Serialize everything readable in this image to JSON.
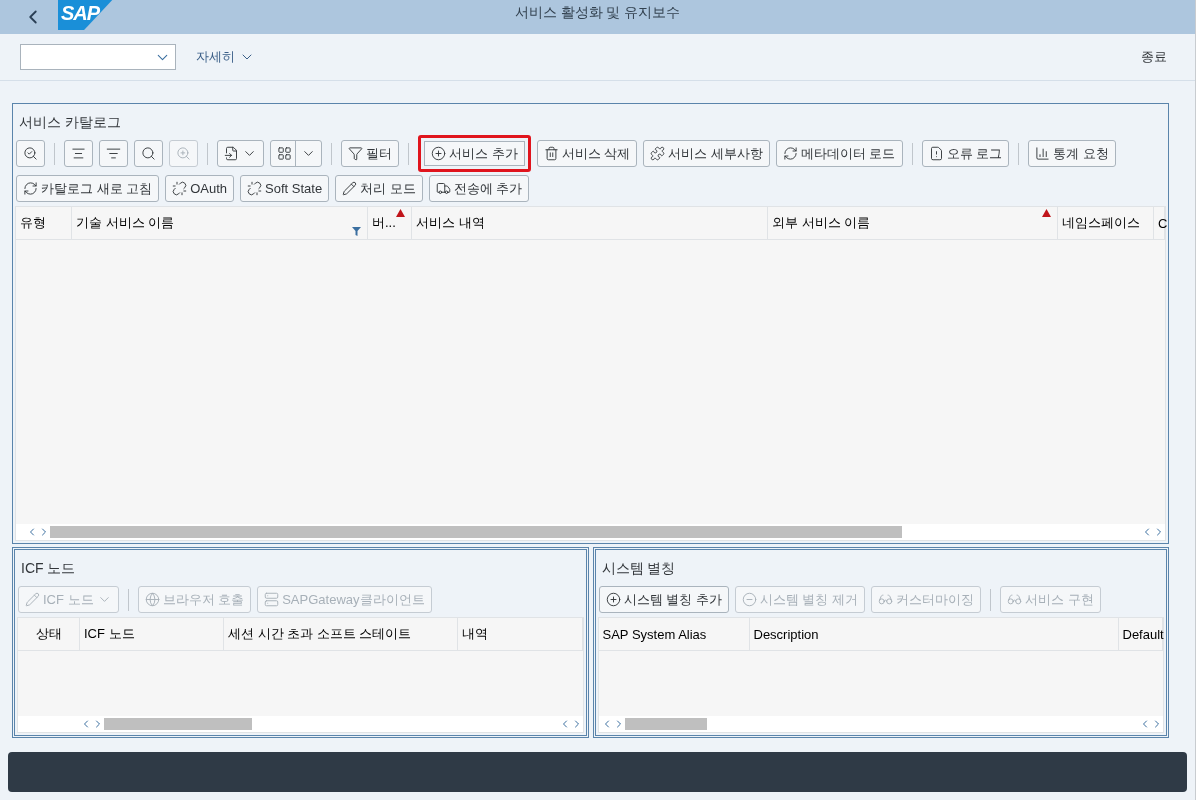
{
  "header": {
    "logo": "SAP",
    "title": "서비스 활성화 및 유지보수"
  },
  "toolbar": {
    "more": "자세히",
    "exit": "종료"
  },
  "catalog": {
    "title": "서비스 카탈로그",
    "toolbar_lines": [
      {
        "groups": [
          {
            "buttons": [
              {
                "kind": "icon",
                "disabled": false,
                "highlighted": false
              }
            ]
          },
          {
            "buttons": [
              {
                "kind": "icon",
                "disabled": false,
                "highlighted": false
              },
              {
                "kind": "icon",
                "disabled": false,
                "highlighted": false
              },
              {
                "kind": "icon",
                "disabled": false,
                "highlighted": false
              },
              {
                "kind": "icon",
                "disabled": true,
                "highlighted": false
              }
            ]
          },
          {
            "buttons": [
              {
                "kind": "icon-menu",
                "disabled": false,
                "highlighted": false
              },
              {
                "kind": "split-menu",
                "disabled": false,
                "highlighted": false
              }
            ]
          },
          {
            "buttons": [
              {
                "kind": "text",
                "label": "필터",
                "disabled": false,
                "highlighted": false
              }
            ]
          },
          {
            "buttons": [
              {
                "kind": "text",
                "label": "서비스 추가",
                "disabled": false,
                "highlighted": true
              },
              {
                "kind": "text",
                "label": "서비스 삭제",
                "disabled": false,
                "highlighted": false
              },
              {
                "kind": "text",
                "label": "서비스 세부사항",
                "disabled": false,
                "highlighted": false
              },
              {
                "kind": "text",
                "label": "메타데이터 로드",
                "disabled": false,
                "highlighted": false
              }
            ]
          },
          {
            "buttons": [
              {
                "kind": "text",
                "label": "오류 로그",
                "disabled": false,
                "highlighted": false
              }
            ]
          },
          {
            "buttons": [
              {
                "kind": "text",
                "label": "통계 요청",
                "disabled": false,
                "highlighted": false
              }
            ]
          }
        ]
      },
      {
        "groups": [
          {
            "buttons": [
              {
                "kind": "text",
                "label": "카탈로그 새로 고침",
                "disabled": false,
                "highlighted": false
              },
              {
                "kind": "text",
                "label": "OAuth",
                "disabled": false,
                "highlighted": false
              },
              {
                "kind": "text",
                "label": "Soft State",
                "disabled": false,
                "highlighted": false
              },
              {
                "kind": "text",
                "label": "처리 모드",
                "disabled": false,
                "highlighted": false
              },
              {
                "kind": "text",
                "label": "전송에 추가",
                "disabled": false,
                "highlighted": false
              }
            ]
          }
        ]
      }
    ],
    "columns": [
      {
        "label": "유형",
        "sorted": false,
        "filtered": false
      },
      {
        "label": "기술 서비스 이름",
        "sorted": false,
        "filtered": true
      },
      {
        "label": "버...",
        "sorted": true,
        "filtered": false
      },
      {
        "label": "서비스 내역",
        "sorted": false,
        "filtered": false
      },
      {
        "label": "외부 서비스 이름",
        "sorted": true,
        "filtered": false
      },
      {
        "label": "네임스페이스",
        "sorted": false,
        "filtered": false
      },
      {
        "label": "C",
        "sorted": false,
        "filtered": false
      }
    ]
  },
  "icf": {
    "title": "ICF 노드",
    "toolbar_lines": [
      {
        "groups": [
          {
            "buttons": [
              {
                "kind": "text-menu",
                "label": "ICF 노드",
                "disabled": true
              }
            ]
          },
          {
            "buttons": [
              {
                "kind": "text",
                "label": "브라우저 호출",
                "disabled": true
              },
              {
                "kind": "text",
                "label": "SAPGateway클라이언트",
                "disabled": true
              }
            ]
          }
        ]
      }
    ],
    "columns": [
      {
        "label": "상태",
        "sorted": false,
        "filtered": false
      },
      {
        "label": "ICF 노드",
        "sorted": false,
        "filtered": false
      },
      {
        "label": "세션 시간 초과 소프트 스테이트",
        "sorted": false,
        "filtered": false
      },
      {
        "label": "내역",
        "sorted": false,
        "filtered": false
      }
    ]
  },
  "alias": {
    "title": "시스템 별칭",
    "toolbar_lines": [
      {
        "groups": [
          {
            "buttons": [
              {
                "kind": "text",
                "label": "시스템 별칭 추가",
                "disabled": false
              },
              {
                "kind": "text",
                "label": "시스템 별칭 제거",
                "disabled": true
              },
              {
                "kind": "text",
                "label": "커스터마이징",
                "disabled": true
              }
            ]
          },
          {
            "buttons": [
              {
                "kind": "text",
                "label": "서비스 구현",
                "disabled": true
              }
            ]
          }
        ]
      }
    ],
    "columns": [
      {
        "label": "SAP System Alias",
        "sorted": false,
        "filtered": false
      },
      {
        "label": "Description",
        "sorted": false,
        "filtered": false
      },
      {
        "label": "Default",
        "sorted": false,
        "filtered": false
      }
    ]
  }
}
